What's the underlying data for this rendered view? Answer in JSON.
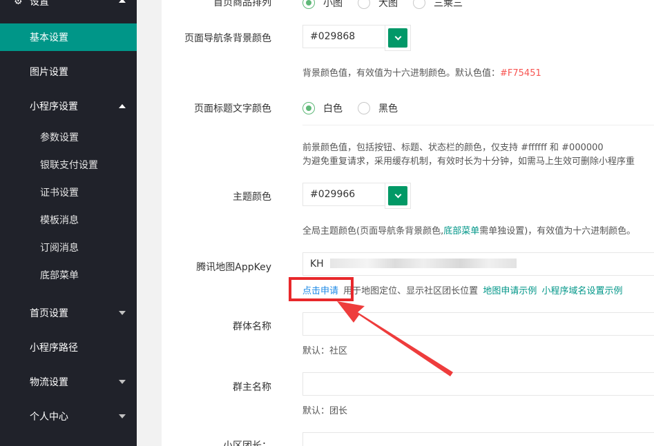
{
  "sidebar": {
    "settings_title": "设置",
    "items": [
      {
        "label": "基本设置"
      },
      {
        "label": "图片设置"
      },
      {
        "label": "小程序设置"
      },
      {
        "label": "参数设置"
      },
      {
        "label": "银联支付设置"
      },
      {
        "label": "证书设置"
      },
      {
        "label": "模板消息"
      },
      {
        "label": "订阅消息"
      },
      {
        "label": "底部菜单"
      },
      {
        "label": "首页设置"
      },
      {
        "label": "小程序路径"
      },
      {
        "label": "物流设置"
      },
      {
        "label": "个人中心"
      }
    ]
  },
  "form": {
    "goods_sort": {
      "label": "首页商品排列",
      "options": [
        "小图",
        "大图",
        "三乘三"
      ],
      "selected": "小图"
    },
    "nav_bg": {
      "label": "页面导航条背景颜色",
      "value": "#029868",
      "swatch": "#029868",
      "help_prefix": "背景颜色值，有效值为十六进制颜色。默认色值：",
      "help_default": "#F75451"
    },
    "title_color": {
      "label": "页面标题文字颜色",
      "options": [
        "白色",
        "黑色"
      ],
      "selected": "白色",
      "help_line1": "前景颜色值，包括按钮、标题、状态栏的颜色，仅支持 #ffffff 和 #000000",
      "help_line2": "为避免重复请求，采用缓存机制，有效时长为十分钟，如需马上生效可删除小程序重"
    },
    "theme_color": {
      "label": "主题颜色",
      "value": "#029966",
      "swatch": "#029966",
      "help_prefix": "全局主题颜色(页面导航条背景颜色,",
      "help_link": "底部菜单",
      "help_suffix": "需单独设置)，有效值为十六进制颜色。"
    },
    "map_key": {
      "label": "腾讯地图AppKey",
      "value": "KH",
      "apply_link": "点击申请",
      "help_text": "用于地图定位、显示社区团长位置",
      "example_link": "地图申请示例",
      "domain_link": "小程序域名设置示例"
    },
    "group_name": {
      "label": "群体名称",
      "value": "",
      "help": "默认：社区"
    },
    "leader_name": {
      "label": "群主名称",
      "value": "",
      "help": "默认：团长"
    },
    "community_leader": {
      "label": "小区团长："
    }
  },
  "colors": {
    "sidebar_bg": "#20222a",
    "active": "#009688",
    "highlight": "#e8282b",
    "link_blue": "#1e8ae6"
  }
}
